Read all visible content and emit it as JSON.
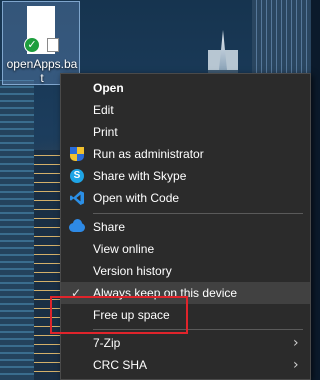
{
  "desktop_icon": {
    "file_name": "openApps.bat",
    "sync_status_glyph": "✓"
  },
  "context_menu": {
    "items": [
      {
        "label": "Open",
        "icon": "none",
        "bold": true
      },
      {
        "label": "Edit",
        "icon": "none"
      },
      {
        "label": "Print",
        "icon": "none"
      },
      {
        "label": "Run as administrator",
        "icon": "uac-shield-icon"
      },
      {
        "label": "Share with Skype",
        "icon": "skype-icon",
        "icon_glyph": "S"
      },
      {
        "label": "Open with Code",
        "icon": "vscode-icon"
      },
      {
        "label": "Share",
        "icon": "onedrive-cloud-icon"
      },
      {
        "label": "View online",
        "icon": "none"
      },
      {
        "label": "Version history",
        "icon": "none"
      },
      {
        "label": "Always keep on this device",
        "icon": "checkmark-icon",
        "check_glyph": "✓",
        "hovered": true
      },
      {
        "label": "Free up space",
        "icon": "none",
        "highlighted": true
      },
      {
        "label": "7-Zip",
        "icon": "none",
        "submenu": true
      },
      {
        "label": "CRC SHA",
        "icon": "none",
        "submenu": true
      }
    ],
    "submenu_arrow": "›"
  },
  "colors": {
    "menu_bg": "#2b2b2b",
    "menu_hover": "#414141",
    "highlight_box": "#e0242b",
    "vscode_blue": "#2b8fe6"
  }
}
